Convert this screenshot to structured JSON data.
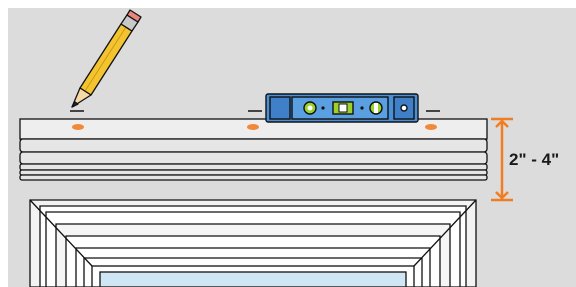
{
  "illustration": {
    "measurement_label": "2\" - 4\"",
    "colors": {
      "wall": "#dcdcdc",
      "panel": "#eeeeee",
      "outline": "#111111",
      "level_blue": "#4a90d9",
      "level_blue_dark": "#2f6db3",
      "bubble": "#9bd12b",
      "mark": "#f08a3a",
      "dimension": "#f07d22",
      "pencil_body": "#f4c430",
      "glass": "#cfe6f4"
    },
    "icons": {
      "pencil": "pencil-icon",
      "level": "spirit-level-icon",
      "dimension_arrow": "double-arrow-icon"
    }
  }
}
